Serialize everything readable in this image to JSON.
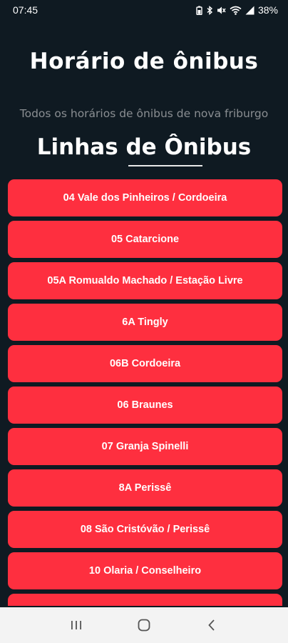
{
  "status_bar": {
    "time": "07:45",
    "battery": "38%",
    "icons": [
      "battery-saver-icon",
      "bluetooth-icon",
      "mute-icon",
      "wifi-icon",
      "signal-icon"
    ]
  },
  "header": {
    "title": "Horário de ônibus",
    "subtitle": "Todos os horários de ônibus de nova friburgo"
  },
  "section": {
    "title": "Linhas de Ônibus"
  },
  "routes": [
    "04 Vale dos Pinheiros / Cordoeira",
    "05 Catarcione",
    "05A Romualdo Machado / Estação Livre",
    "6A Tingly",
    "06B Cordoeira",
    "06 Braunes",
    "07 Granja Spinelli",
    "8A Perissê",
    "08 São Cristóvão / Perissê",
    "10 Olaria / Conselheiro",
    ""
  ],
  "nav_bar": {
    "buttons": [
      "recents-icon",
      "home-icon",
      "back-icon"
    ]
  },
  "colors": {
    "background": "#0f1a22",
    "button": "#fe2f3f",
    "subtitle": "#8a8e92"
  }
}
